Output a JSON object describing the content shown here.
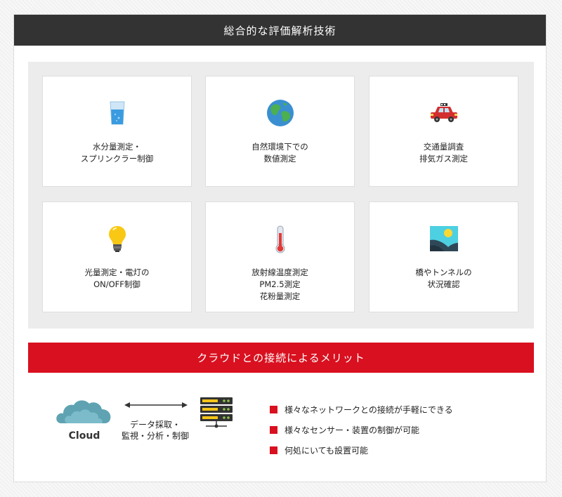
{
  "header": {
    "title": "総合的な評価解析技術"
  },
  "cards": [
    {
      "icon": "water-glass-icon",
      "label": "水分量測定・\nスプリンクラー制御"
    },
    {
      "icon": "globe-icon",
      "label": "自然環境下での\n数値測定"
    },
    {
      "icon": "car-icon",
      "label": "交通量調査\n排気ガス測定"
    },
    {
      "icon": "lightbulb-icon",
      "label": "光量測定・電灯の\nON/OFF制御"
    },
    {
      "icon": "thermometer-icon",
      "label": "放射線温度測定\nPM2.5測定\n花粉量測定"
    },
    {
      "icon": "landscape-image-icon",
      "label": "橋やトンネルの\n状況確認"
    }
  ],
  "cloud_section": {
    "title": "クラウドとの接続によるメリット",
    "cloud_label": "Cloud",
    "arrow_label": "データ採取・\n監視・分析・制御",
    "benefits": [
      "様々なネットワークとの接続が手軽にできる",
      "様々なセンサー・装置の制御が可能",
      "何処にいても設置可能"
    ]
  },
  "colors": {
    "accent": "#d9101f",
    "header_bg": "#333333",
    "cloud": "#5fa3b3"
  }
}
